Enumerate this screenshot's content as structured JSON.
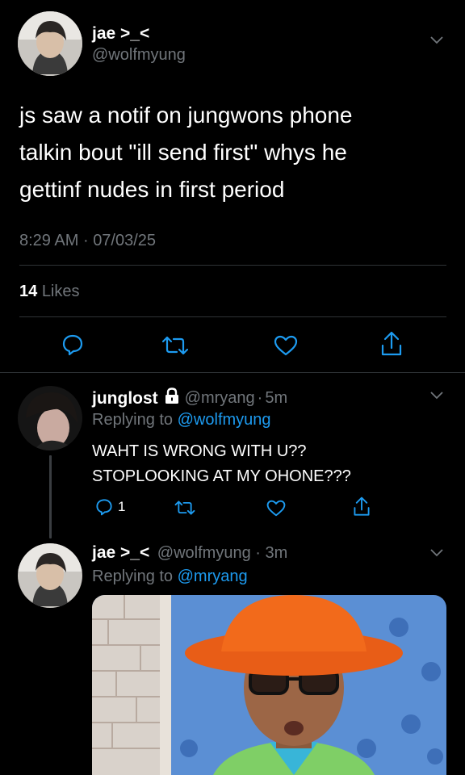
{
  "main_tweet": {
    "display_name": "jae >_<",
    "handle": "@wolfmyung",
    "text_lines": [
      "js saw a notif on jungwons phone",
      "talkin bout \"ill send first\" whys he",
      "gettinf nudes in first period"
    ],
    "time": "8:29 AM",
    "separator": "·",
    "date": "07/03/25",
    "likes_count": "14",
    "likes_label": "Likes"
  },
  "reply_1": {
    "display_name": "junglost",
    "handle": "@mryang",
    "separator": "·",
    "age": "5m",
    "replying_to_label": "Replying to",
    "replying_to_handle": "@wolfmyung",
    "text_lines": [
      "WAHT IS WRONG WITH U??",
      "STOPLOOKING AT MY OHONE???"
    ],
    "reply_count": "1"
  },
  "reply_2": {
    "display_name": "jae >_<",
    "handle": "@wolfmyung",
    "separator": "·",
    "age": "3m",
    "replying_to_label": "Replying to",
    "replying_to_handle": "@mryang"
  },
  "colors": {
    "background": "#000000",
    "muted": "#71767b",
    "link": "#1d9bf0",
    "divider": "#2f3336",
    "meme_bg": "#5b8fd4",
    "meme_hat": "#f26a1b"
  },
  "icons": [
    "chevron-down-icon",
    "reply-icon",
    "retweet-icon",
    "like-icon",
    "share-icon",
    "lock-icon"
  ]
}
